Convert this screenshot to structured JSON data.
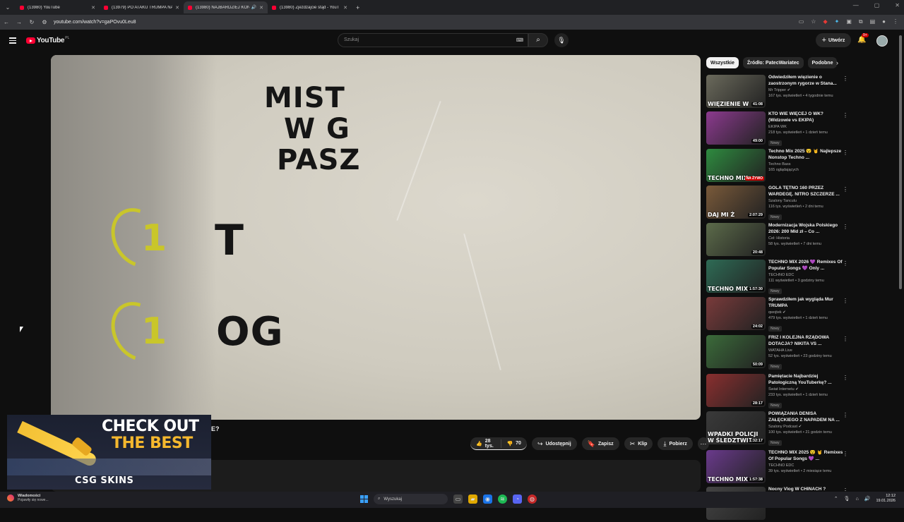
{
  "browser": {
    "tabs": [
      {
        "title": "(13980) YouTube",
        "active": false,
        "audio": false
      },
      {
        "title": "(13979) PO ATAKU TRUMPA NA",
        "active": false,
        "audio": false
      },
      {
        "title": "(13980) NAJBARDZIEJ KON",
        "active": true,
        "audio": true
      },
      {
        "title": "(13980) Zjeżdżajcie stąd - YouT",
        "active": false,
        "audio": false
      }
    ],
    "url": "youtube.com/watch?v=gaPOvu0Leu8"
  },
  "youtube": {
    "logo_text": "YouTube",
    "region": "PL",
    "search_placeholder": "Szukaj",
    "create_label": "Utwórz",
    "notifications_badge": "9+"
  },
  "video": {
    "frame_text": {
      "line1": "MIST",
      "line2": "W G",
      "line3": "PASZ",
      "row1_num": "1",
      "row1_text": "T",
      "row2_num": "1",
      "row2_text": "OG"
    },
    "title_fragment": "E?",
    "likes": "28 tys.",
    "dislikes": "70",
    "share_label": "Udostępnij",
    "save_label": "Zapisz",
    "clip_label": "Klip",
    "download_label": "Pobierz"
  },
  "ad": {
    "headline1": "CHECK OUT",
    "headline2": "THE BEST",
    "brand": "CSG SKINS"
  },
  "chips": [
    {
      "label": "Wszystkie",
      "active": true
    },
    {
      "label": "Źródło: PatecWariatec",
      "active": false
    },
    {
      "label": "Podobne",
      "active": false
    }
  ],
  "recommendations": [
    {
      "title": "Odwiedziłem więzienie o zaostrzonym rygorze w Stana...",
      "channel": "Mr Tripper",
      "verified": true,
      "meta": "167 tys. wyświetleń • 4 tygodnie temu",
      "duration": "41:08",
      "overlay": "WIĘZIENIE W",
      "new": false,
      "color": "#6b6a5c"
    },
    {
      "title": "KTO WIE WIĘCEJ O WK? (Widzowie vs EKIPA)",
      "channel": "EKIPA WK",
      "verified": false,
      "meta": "218 tys. wyświetleń • 1 dzień temu",
      "duration": "49:00",
      "overlay": "",
      "new": true,
      "color": "#8c3a8f"
    },
    {
      "title": "Techno Mix 2025 😵 🤘 Najlepsze Nonstop Techno ...",
      "channel": "Techno Bass",
      "verified": false,
      "meta": "165 oglądających",
      "duration": "NA ŻYWO",
      "overlay": "TECHNO MIX",
      "new": false,
      "live": true,
      "color": "#2e8b3f"
    },
    {
      "title": "GOLA TĘTNO 160 PRZEZ WARDEGĘ. NITRO SZCZERZE ...",
      "channel": "Szalony Tanculu",
      "verified": false,
      "meta": "116 tys. wyświetleń • 2 dni temu",
      "duration": "2:07:29",
      "overlay": "DAJ MI Ż",
      "new": true,
      "color": "#7a5a3a"
    },
    {
      "title": "Modernizacja Wojska Polskiego 2026: 200 Mld zł – Co ...",
      "channel": "Cel: Historia",
      "verified": false,
      "meta": "58 tys. wyświetleń • 7 dni temu",
      "duration": "20:48",
      "overlay": "",
      "new": false,
      "color": "#5c6b4a"
    },
    {
      "title": "TECHNO MIX 2026 💜 Remixes Of Popular Songs 💜 Only ...",
      "channel": "TECHNO EDC",
      "verified": false,
      "meta": "111 wyświetleń • 3 godziny temu",
      "duration": "1:57:30",
      "overlay": "TECHNO MIX",
      "new": true,
      "color": "#2e6b55"
    },
    {
      "title": "Sprawdziłem jak wygląda Mur TRUMPA",
      "channel": "qwojtek",
      "verified": true,
      "meta": "479 tys. wyświetleń • 1 dzień temu",
      "duration": "24:02",
      "overlay": "",
      "new": true,
      "color": "#7a3b3b"
    },
    {
      "title": "FRIZ I KOLEJNA RZĄDOWA DOTACJA? NIKITA VS ...",
      "channel": "WATAHA Live",
      "verified": false,
      "meta": "52 tys. wyświetleń • 23 godziny temu",
      "duration": "50:09",
      "overlay": "",
      "new": true,
      "color": "#3b6b3a"
    },
    {
      "title": "Pamiętacie Najbardziej Patologiczną YouTuberkę? ...",
      "channel": "Świat Internetu",
      "verified": true,
      "meta": "233 tys. wyświetleń • 1 dzień temu",
      "duration": "28:17",
      "overlay": "",
      "new": true,
      "color": "#8a2f2f"
    },
    {
      "title": "POWIĄZANIA DENISA ZAŁĘCKIEGO Z NAPADEM NA ...",
      "channel": "Szalony Podcast",
      "verified": true,
      "meta": "100 tys. wyświetleń • 21 godzin temu",
      "duration": "1:32:17",
      "overlay": "WPADKI POLICJI W ŚLEDZTWIE",
      "new": true,
      "color": "#3a3a3a"
    },
    {
      "title": "TECHNO MIX 2025 😵 🤘 Remixes Of Popular Songs 💜 ...",
      "channel": "TECHNO EDC",
      "verified": false,
      "meta": "39 tys. wyświetleń • 2 miesiące temu",
      "duration": "1:57:38",
      "overlay": "TECHNO MIX",
      "new": false,
      "color": "#6a3a8c"
    },
    {
      "title": "Nocny Vlog W CHINACH ?",
      "channel": "",
      "verified": false,
      "meta": "",
      "duration": "",
      "overlay": "",
      "new": false,
      "color": "#444"
    }
  ],
  "taskbar": {
    "notif_title": "Wiadomości",
    "notif_sub": "Pojawiły się nowe...",
    "search_label": "Wyszukaj",
    "time": "12:12",
    "date": "19.01.2026"
  }
}
